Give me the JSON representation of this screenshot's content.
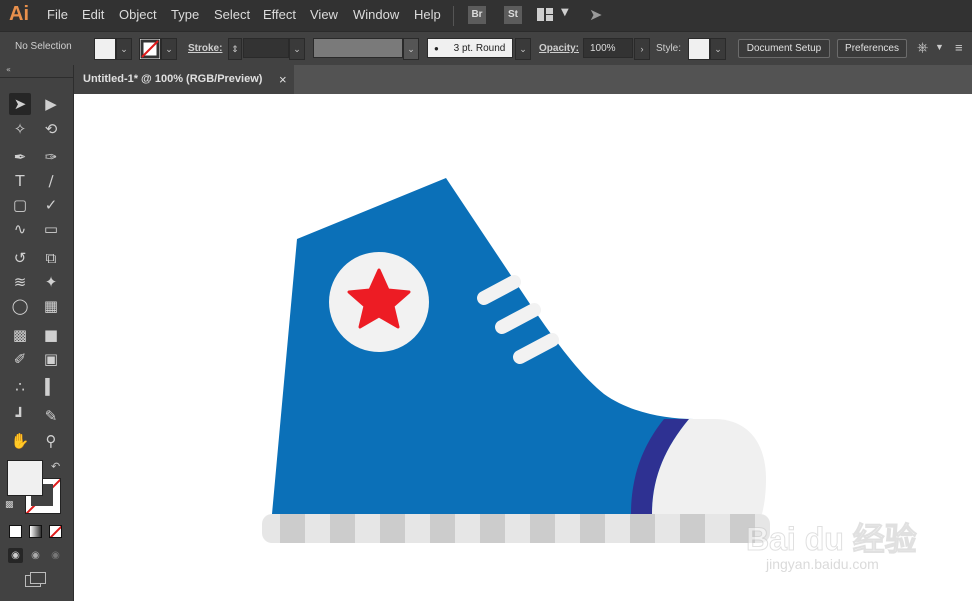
{
  "app": {
    "logo": "Ai"
  },
  "menu": [
    "File",
    "Edit",
    "Object",
    "Type",
    "Select",
    "Effect",
    "View",
    "Window",
    "Help"
  ],
  "app_buttons": {
    "bridge": "Br",
    "stock": "St"
  },
  "control_bar": {
    "selection_label": "No Selection",
    "stroke_label": "Stroke:",
    "brush_value": "3 pt. Round",
    "opacity_label": "Opacity:",
    "opacity_value": "100%",
    "style_label": "Style:",
    "document_setup": "Document Setup",
    "preferences": "Preferences"
  },
  "document_tab": {
    "title": "Untitled-1* @ 100% (RGB/Preview)",
    "close": "×"
  },
  "colors": {
    "shoe_blue": "#0b70b8",
    "toe_stripe": "#2e3192",
    "sole_light": "#e6e6e6",
    "sole_dark": "#cccccc",
    "badge_bg": "#f2f2f2",
    "star": "#ed1c24",
    "accent_orange": "#e8904c"
  },
  "watermark": {
    "brand": "Bai du 经验",
    "url": "jingyan.baidu.com"
  }
}
